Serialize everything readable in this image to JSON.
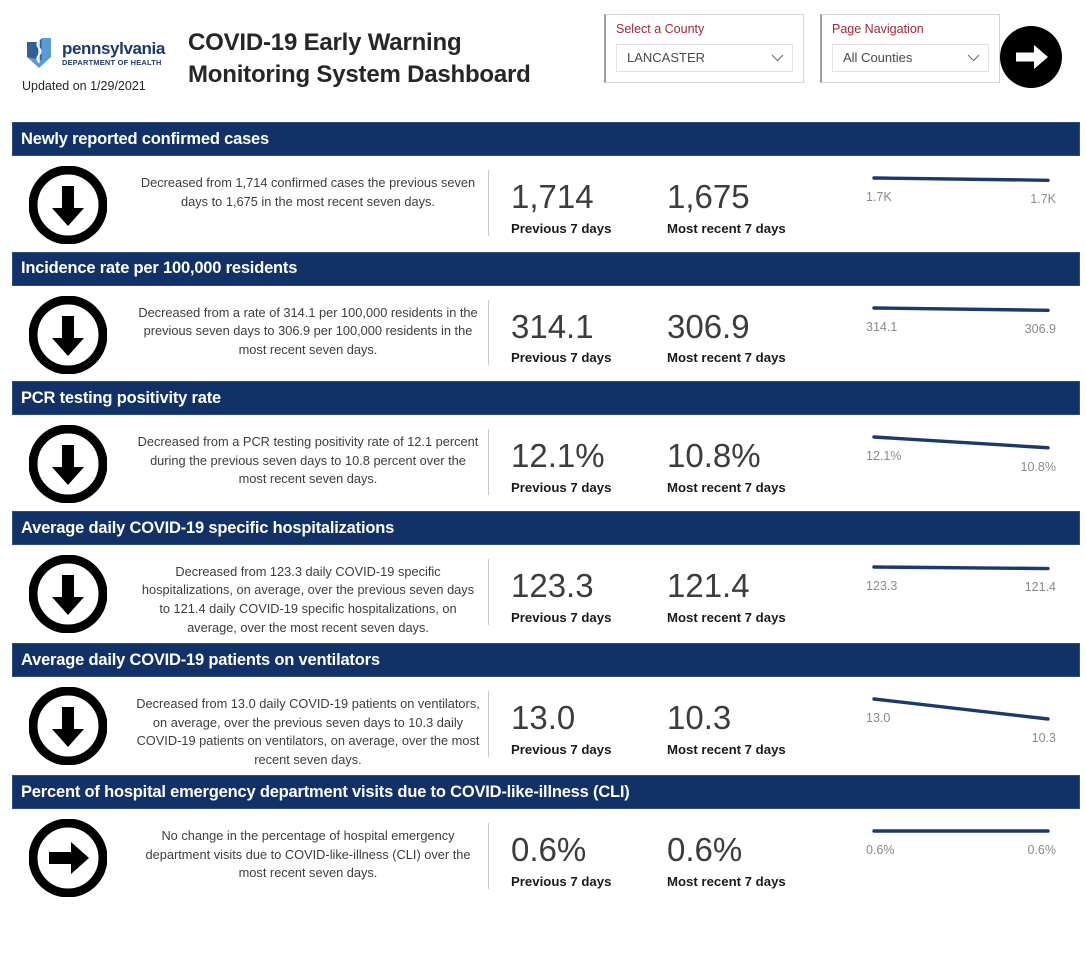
{
  "header": {
    "logo": {
      "icon": "pa-keystone-caduceus-icon",
      "main": "pennsylvania",
      "sub": "DEPARTMENT OF HEALTH"
    },
    "updated": "Updated on 1/29/2021",
    "title": "COVID-19 Early Warning Monitoring System Dashboard",
    "county_filter": {
      "label": "Select a County",
      "value": "LANCASTER",
      "placeholder": "LANCASTER",
      "chevron": "chevron-down-icon"
    },
    "page_navigation": {
      "label": "Page Navigation",
      "value": "All Counties",
      "placeholder": "All Counties",
      "chevron": "chevron-down-icon"
    },
    "next_button": {
      "icon": "arrow-right-circle-icon",
      "aria": "Next page"
    }
  },
  "labels": {
    "previous": "Previous 7 days",
    "recent": "Most recent 7 days"
  },
  "colors": {
    "band_navy": "#123166",
    "spark_navy": "#1b3a6b",
    "label_red": "#a32638",
    "brand_blue": "#1b3a6b"
  },
  "metrics": [
    {
      "title": "Newly reported confirmed cases",
      "trend": "down",
      "trend_icon": "arrow-down-circle-icon",
      "description": "Decreased from 1,714 confirmed cases the previous seven days to 1,675 in the most recent seven days.",
      "previous_value": "1,714",
      "recent_value": "1,675",
      "spark_left_label": "1.7K",
      "spark_right_label": "1.7K"
    },
    {
      "title": "Incidence rate per 100,000 residents",
      "trend": "down",
      "trend_icon": "arrow-down-circle-icon",
      "description": "Decreased from a rate of 314.1 per 100,000 residents in the previous seven days to 306.9 per 100,000 residents in the most recent seven days.",
      "previous_value": "314.1",
      "recent_value": "306.9",
      "spark_left_label": "314.1",
      "spark_right_label": "306.9"
    },
    {
      "title": "PCR testing positivity rate",
      "trend": "down",
      "trend_icon": "arrow-down-circle-icon",
      "description": "Decreased from a PCR testing positivity rate of 12.1 percent during the previous seven days to 10.8 percent over the most recent seven days.",
      "previous_value": "12.1%",
      "recent_value": "10.8%",
      "spark_left_label": "12.1%",
      "spark_right_label": "10.8%"
    },
    {
      "title": "Average daily COVID-19 specific hospitalizations",
      "trend": "down",
      "trend_icon": "arrow-down-circle-icon",
      "description": "Decreased from 123.3 daily COVID-19 specific hospitalizations, on average, over the previous seven days to 121.4 daily COVID-19 specific hospitalizations, on average, over the most recent seven days.",
      "previous_value": "123.3",
      "recent_value": "121.4",
      "spark_left_label": "123.3",
      "spark_right_label": "121.4"
    },
    {
      "title": "Average daily COVID-19 patients on ventilators",
      "trend": "down",
      "trend_icon": "arrow-down-circle-icon",
      "description": "Decreased from 13.0 daily COVID-19 patients on ventilators, on average, over the previous seven days to 10.3 daily COVID-19 patients on ventilators, on average, over the most recent seven days.",
      "previous_value": "13.0",
      "recent_value": "10.3",
      "spark_left_label": "13.0",
      "spark_right_label": "10.3"
    },
    {
      "title": "Percent of hospital emergency department visits due to COVID-like-illness (CLI)",
      "trend": "flat",
      "trend_icon": "arrow-right-circle-icon",
      "description": "No change in the percentage of hospital emergency department visits due to COVID-like-illness (CLI) over the most recent seven days.",
      "previous_value": "0.6%",
      "recent_value": "0.6%",
      "spark_left_label": "0.6%",
      "spark_right_label": "0.6%"
    }
  ],
  "chart_data": [
    {
      "type": "line",
      "title": "Newly reported confirmed cases",
      "categories": [
        "Previous 7 days",
        "Most recent 7 days"
      ],
      "values": [
        1714,
        1675
      ],
      "tick_labels": [
        "1.7K",
        "1.7K"
      ],
      "ylabel": "",
      "xlabel": "",
      "grid": false,
      "legend": "none"
    },
    {
      "type": "line",
      "title": "Incidence rate per 100,000 residents",
      "categories": [
        "Previous 7 days",
        "Most recent 7 days"
      ],
      "values": [
        314.1,
        306.9
      ],
      "tick_labels": [
        "314.1",
        "306.9"
      ],
      "ylabel": "",
      "xlabel": "",
      "grid": false,
      "legend": "none"
    },
    {
      "type": "line",
      "title": "PCR testing positivity rate",
      "categories": [
        "Previous 7 days",
        "Most recent 7 days"
      ],
      "values": [
        12.1,
        10.8
      ],
      "tick_labels": [
        "12.1%",
        "10.8%"
      ],
      "ylabel": "",
      "xlabel": "",
      "grid": false,
      "legend": "none"
    },
    {
      "type": "line",
      "title": "Average daily COVID-19 specific hospitalizations",
      "categories": [
        "Previous 7 days",
        "Most recent 7 days"
      ],
      "values": [
        123.3,
        121.4
      ],
      "tick_labels": [
        "123.3",
        "121.4"
      ],
      "ylabel": "",
      "xlabel": "",
      "grid": false,
      "legend": "none"
    },
    {
      "type": "line",
      "title": "Average daily COVID-19 patients on ventilators",
      "categories": [
        "Previous 7 days",
        "Most recent 7 days"
      ],
      "values": [
        13.0,
        10.3
      ],
      "tick_labels": [
        "13.0",
        "10.3"
      ],
      "ylabel": "",
      "xlabel": "",
      "grid": false,
      "legend": "none"
    },
    {
      "type": "line",
      "title": "Percent of hospital emergency department visits due to COVID-like-illness (CLI)",
      "categories": [
        "Previous 7 days",
        "Most recent 7 days"
      ],
      "values": [
        0.6,
        0.6
      ],
      "tick_labels": [
        "0.6%",
        "0.6%"
      ],
      "ylabel": "",
      "xlabel": "",
      "grid": false,
      "legend": "none"
    }
  ]
}
